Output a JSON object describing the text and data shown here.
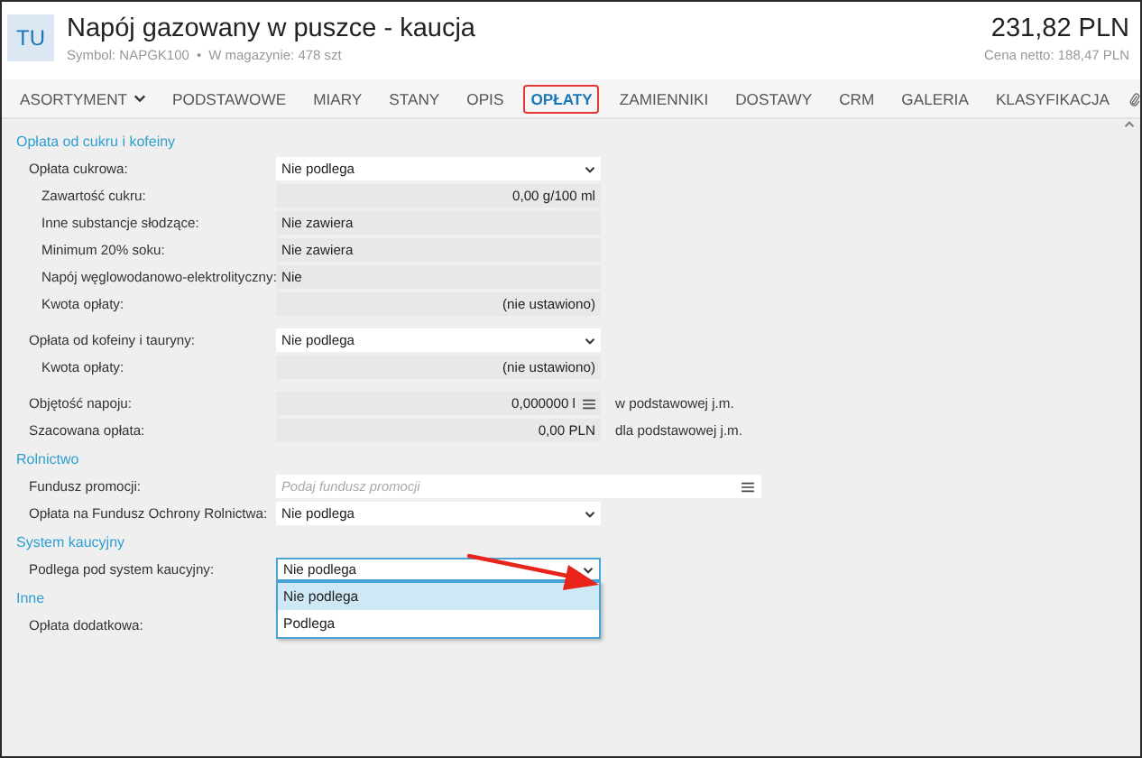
{
  "header": {
    "avatar": "TU",
    "title": "Napój gazowany w puszce - kaucja",
    "symbol": "Symbol: NAPGK100",
    "separator": "•",
    "stock": "W magazynie: 478 szt",
    "price": "231,82 PLN",
    "net_price": "Cena netto: 188,47 PLN"
  },
  "tabs": [
    {
      "label": "ASORTYMENT",
      "selected": false,
      "dropdown": true
    },
    {
      "label": "PODSTAWOWE",
      "selected": false
    },
    {
      "label": "MIARY",
      "selected": false
    },
    {
      "label": "STANY",
      "selected": false
    },
    {
      "label": "OPIS",
      "selected": false
    },
    {
      "label": "OPŁATY",
      "selected": true
    },
    {
      "label": "ZAMIENNIKI",
      "selected": false
    },
    {
      "label": "DOSTAWY",
      "selected": false
    },
    {
      "label": "CRM",
      "selected": false
    },
    {
      "label": "GALERIA",
      "selected": false
    },
    {
      "label": "KLASYFIKACJA",
      "selected": false
    }
  ],
  "sections": [
    {
      "title": "Opłata od cukru i kofeiny",
      "rows": [
        {
          "label": "Opłata cukrowa:",
          "field": {
            "kind": "select",
            "value": "Nie podlega"
          },
          "children": [
            {
              "label": "Zawartość cukru:",
              "field": {
                "kind": "number",
                "value": "0,00 g/100 ml"
              }
            },
            {
              "label": "Inne substancje słodzące:",
              "field": {
                "kind": "readonly",
                "value": "Nie zawiera"
              }
            },
            {
              "label": "Minimum 20% soku:",
              "field": {
                "kind": "readonly",
                "value": "Nie zawiera"
              }
            },
            {
              "label": "Napój węglowodanowo-elektrolityczny:",
              "field": {
                "kind": "readonly",
                "value": "Nie"
              }
            },
            {
              "label": "Kwota opłaty:",
              "field": {
                "kind": "number",
                "value": "(nie ustawiono)"
              }
            }
          ]
        },
        {
          "label": "Opłata od kofeiny i tauryny:",
          "field": {
            "kind": "select",
            "value": "Nie podlega"
          },
          "gap": true,
          "children": [
            {
              "label": "Kwota opłaty:",
              "field": {
                "kind": "number",
                "value": "(nie ustawiono)"
              }
            }
          ]
        },
        {
          "label": "Objętość napoju:",
          "field": {
            "kind": "number-list",
            "value": "0,000000 l"
          },
          "suffix": "w podstawowej j.m.",
          "gap": true
        },
        {
          "label": "Szacowana opłata:",
          "field": {
            "kind": "number",
            "value": "0,00 PLN"
          },
          "suffix": "dla podstawowej j.m."
        }
      ]
    },
    {
      "title": "Rolnictwo",
      "rows": [
        {
          "label": "Fundusz promocji:",
          "field": {
            "kind": "lookup",
            "placeholder": "Podaj fundusz promocji"
          }
        },
        {
          "label": "Opłata na Fundusz Ochrony Rolnictwa:",
          "field": {
            "kind": "select",
            "value": "Nie podlega"
          }
        }
      ]
    },
    {
      "title": "System kaucyjny",
      "rows": [
        {
          "label": "Podlega pod system kaucyjny:",
          "field": {
            "kind": "select",
            "value": "Nie podlega",
            "open": true,
            "options": [
              {
                "label": "Nie podlega",
                "selected": true
              },
              {
                "label": "Podlega",
                "selected": false
              }
            ]
          }
        }
      ]
    },
    {
      "title": "Inne",
      "rows": [
        {
          "label": "Opłata dodatkowa:"
        }
      ]
    }
  ]
}
